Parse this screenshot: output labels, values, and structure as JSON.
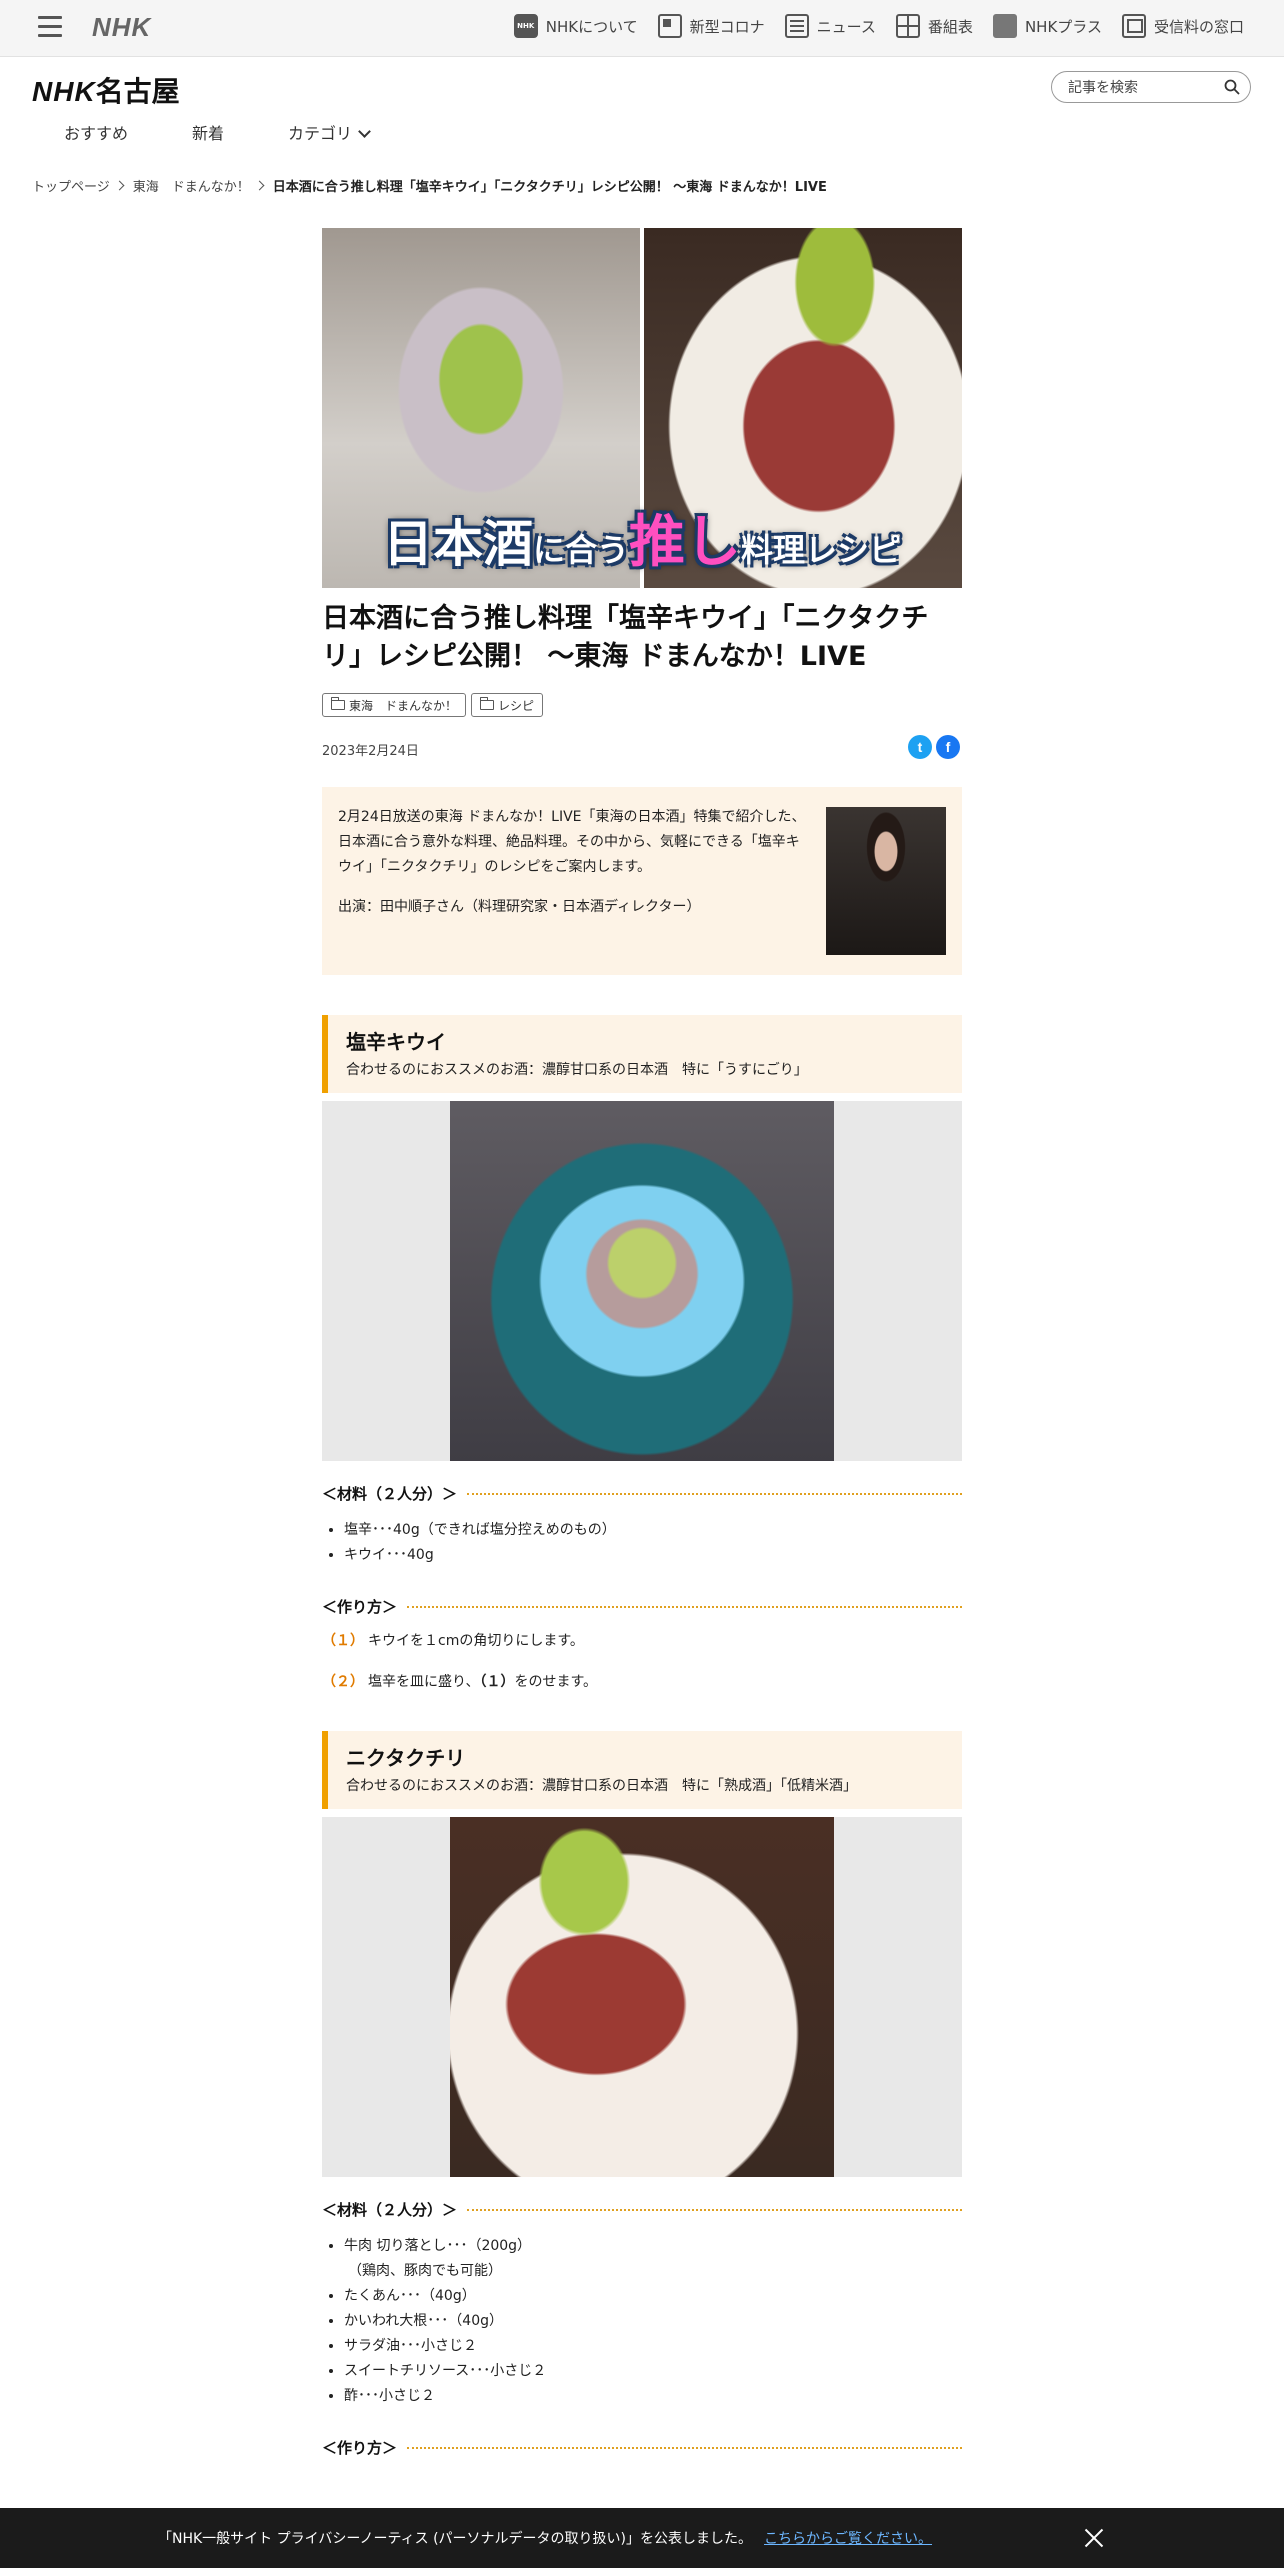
{
  "topbar": {
    "logo": "NHK",
    "nav": [
      {
        "label": "NHKについて",
        "icon": "nhk-icon"
      },
      {
        "label": "新型コロナ",
        "icon": "corona-info-icon"
      },
      {
        "label": "ニュース",
        "icon": "news-icon"
      },
      {
        "label": "番組表",
        "icon": "program-guide-icon"
      },
      {
        "label": "NHKプラス",
        "icon": "nhk-plus-icon"
      },
      {
        "label": "受信料の窓口",
        "icon": "fee-window-icon"
      }
    ]
  },
  "header": {
    "logo_brand": "NHK",
    "logo_city": "名古屋",
    "search_placeholder": "記事を検索",
    "subnav": [
      "おすすめ",
      "新着",
      "カテゴリ"
    ]
  },
  "breadcrumb": {
    "items": [
      "トップページ",
      "東海　ドまんなか！"
    ],
    "current": "日本酒に合う推し料理「塩辛キウイ」「ニクタクチリ」レシピ公開！ ～東海 ドまんなか！LIVE"
  },
  "article": {
    "hero_caption": {
      "a": "日本酒",
      "b": "に合う",
      "c": "推し",
      "d": "料理レシピ"
    },
    "title": "日本酒に合う推し料理「塩辛キウイ」「ニクタクチリ」レシピ公開！ ～東海 ドまんなか！LIVE",
    "tags": [
      "東海　ドまんなか！",
      "レシピ"
    ],
    "date": "2023年2月24日",
    "share": {
      "twitter": "t",
      "facebook": "f"
    },
    "intro": {
      "p1": "2月24日放送の東海 ドまんなか！LIVE「東海の日本酒」特集で紹介した、日本酒に合う意外な料理、絶品料理。その中から、気軽にできる「塩辛キウイ」「ニクタクチリ」のレシピをご案内します。",
      "p2": "出演：田中順子さん（料理研究家・日本酒ディレクター）"
    },
    "recipes": [
      {
        "name": "塩辛キウイ",
        "pairing": "合わせるのにおススメのお酒：濃醇甘口系の日本酒　特に「うすにごり」",
        "ingredients_heading": "＜材料（２人分）＞",
        "ingredients": [
          "塩辛･･･40g（できれば塩分控えめのもの）",
          "キウイ･･･40g"
        ],
        "steps_heading": "＜作り方＞",
        "steps": [
          {
            "num": "（１）",
            "text": "キウイを１cmの角切りにします。"
          },
          {
            "num": "（２）",
            "text_a": "塩辛を皿に盛り、",
            "ref": "（１）",
            "text_b": "をのせます。"
          }
        ]
      },
      {
        "name": "ニクタクチリ",
        "pairing": "合わせるのにおススメのお酒：濃醇甘口系の日本酒　特に「熟成酒」「低精米酒」",
        "ingredients_heading": "＜材料（２人分）＞",
        "ingredients": [
          "牛肉 切り落とし･･･（200g）",
          "（鶏肉、豚肉でも可能）",
          "たくあん･･･（40g）",
          "かいわれ大根･･･（40g）",
          "サラダ油･･･小さじ２",
          "スイートチリソース･･･小さじ２",
          "酢･･･小さじ２"
        ],
        "steps_heading": "＜作り方＞"
      }
    ]
  },
  "cookie_bar": {
    "text": "「NHK一般サイト プライバシーノーティス (パーソナルデータの取り扱い)」を公表しました。",
    "link": "こちらからご覧ください。"
  }
}
